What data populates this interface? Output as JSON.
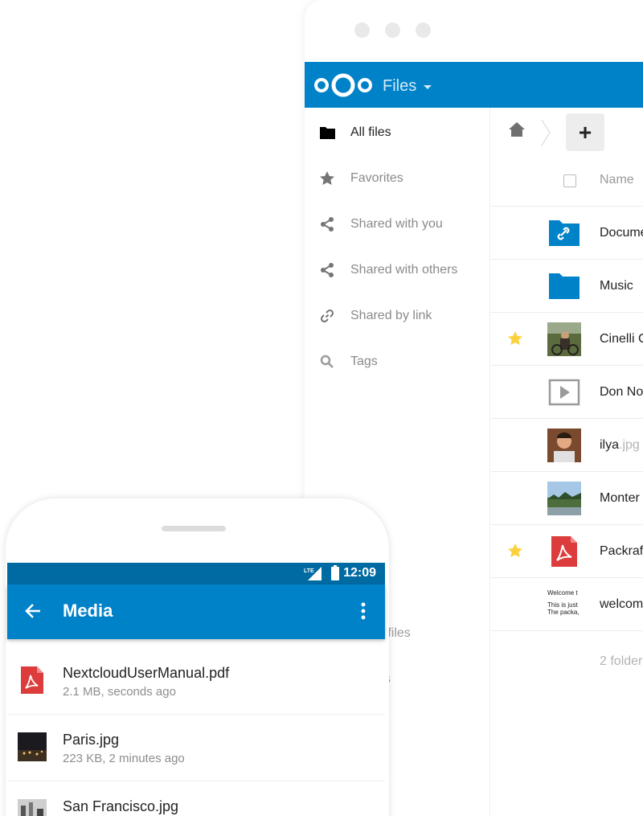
{
  "desktop": {
    "app_title": "Files",
    "sidebar": {
      "items": [
        {
          "label": "All files"
        },
        {
          "label": "Favorites"
        },
        {
          "label": "Shared with you"
        },
        {
          "label": "Shared with others"
        },
        {
          "label": "Shared by link"
        },
        {
          "label": "Tags"
        }
      ],
      "partial_items": [
        "d files",
        "gs"
      ]
    },
    "file_list": {
      "new_button": "+",
      "column_name": "Name",
      "rows": [
        {
          "name": "Docume",
          "ext": "",
          "starred": false,
          "type": "shared-folder"
        },
        {
          "name": "Music",
          "ext": "",
          "starred": false,
          "type": "folder"
        },
        {
          "name": "Cinelli C",
          "ext": "",
          "starred": true,
          "type": "photo"
        },
        {
          "name": "Don No",
          "ext": "",
          "starred": false,
          "type": "video"
        },
        {
          "name": "ilya",
          "ext": ".jpg",
          "starred": false,
          "type": "photo"
        },
        {
          "name": "Monter",
          "ext": "",
          "starred": false,
          "type": "photo"
        },
        {
          "name": "Packraf",
          "ext": "",
          "starred": true,
          "type": "pdf"
        },
        {
          "name": "welcom",
          "ext": "",
          "starred": false,
          "type": "text"
        }
      ],
      "summary": "2 folder",
      "text_preview": {
        "line1": "Welcome t",
        "line2": "This is just",
        "line3": "The packa,"
      }
    },
    "colors": {
      "header": "#0082c9",
      "star": "#fcd13d",
      "folder": "#0082c9"
    }
  },
  "phone": {
    "status_bar": {
      "network": "LTE",
      "time": "12:09"
    },
    "app_bar": {
      "title": "Media"
    },
    "files": [
      {
        "title": "NextcloudUserManual.pdf",
        "subtitle": "2.1 MB, seconds ago",
        "icon": "pdf-icon"
      },
      {
        "title": "Paris.jpg",
        "subtitle": "223 KB, 2 minutes ago",
        "icon": "photo-thumbnail"
      },
      {
        "title": "San Francisco.jpg",
        "subtitle": "",
        "icon": "photo-thumbnail"
      }
    ],
    "colors": {
      "status_bar": "#006aa3",
      "app_bar": "#0082c9"
    }
  }
}
